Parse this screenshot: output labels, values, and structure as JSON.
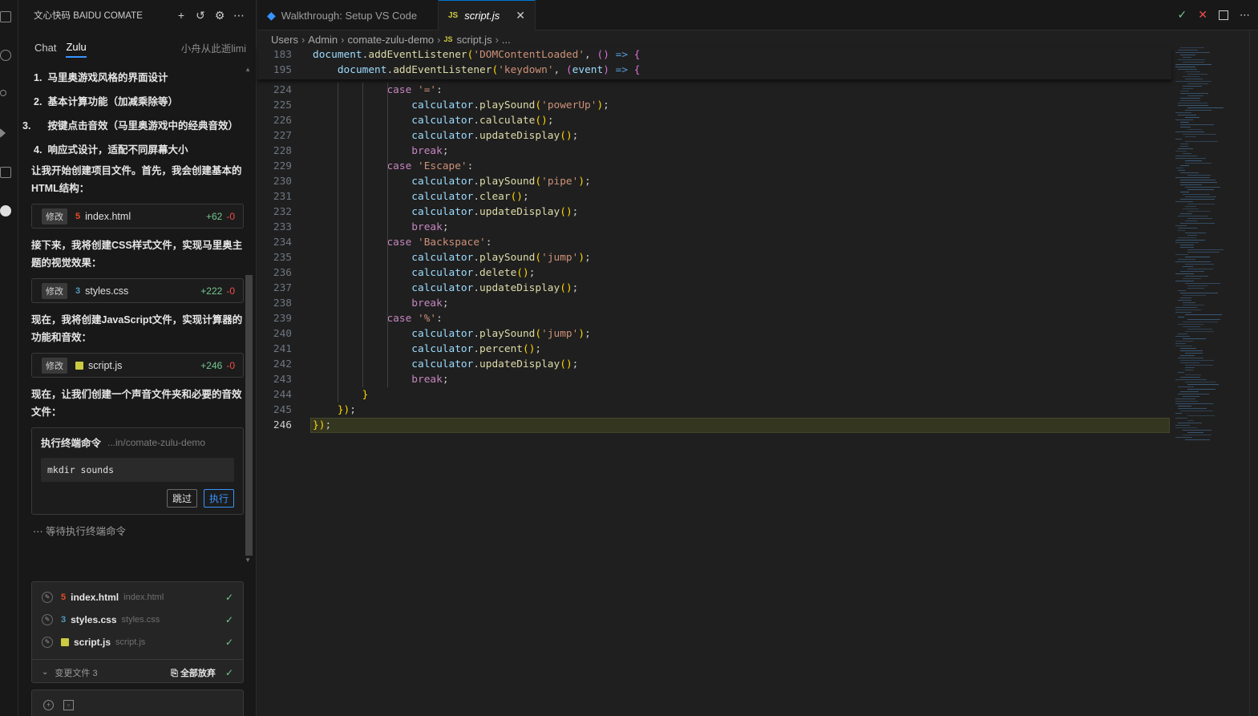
{
  "sidebar": {
    "title": "文心快码 BAIDU COMATE",
    "tabs": {
      "chat": "Chat",
      "zulu": "Zulu"
    },
    "user": "小舟从此逝limi",
    "list": [
      {
        "num": "1.",
        "text": "马里奥游戏风格的界面设计"
      },
      {
        "num": "2.",
        "text": "基本计算功能（加减乘除等）"
      },
      {
        "num": "3.",
        "text": "按键点击音效（马里奥游戏中的经典音效）"
      },
      {
        "num": "4.",
        "text": "响应式设计，适配不同屏幕大小"
      }
    ],
    "para1": "让我开始创建项目文件。首先，我会创建基本的HTML结构：",
    "card_html": {
      "badge": "修改",
      "name": "index.html",
      "add": "+62",
      "del": "-0"
    },
    "para2": "接下来，我将创建CSS样式文件，实现马里奥主题的视觉效果：",
    "card_css": {
      "badge": "修改",
      "name": "styles.css",
      "add": "+222",
      "del": "-0"
    },
    "para3": "现在，我将创建JavaScript文件，实现计算器的功能和音效：",
    "card_js": {
      "badge": "修改",
      "name": "script.js",
      "add": "+246",
      "del": "-0"
    },
    "para4": "现在，让我们创建一个声音文件夹和必要的音效文件：",
    "terminal": {
      "title": "执行终端命令",
      "path": "...in/comate-zulu-demo",
      "command": "mkdir sounds",
      "skip": "跳过",
      "run": "执行"
    },
    "waiting": "等待执行终端命令",
    "changed_files": [
      {
        "name": "index.html",
        "path": "index.html",
        "type": "html"
      },
      {
        "name": "styles.css",
        "path": "styles.css",
        "type": "css"
      },
      {
        "name": "script.js",
        "path": "script.js",
        "type": "js"
      }
    ],
    "changed_count": "变更文件 3",
    "discard_all": "全部放弃"
  },
  "editor": {
    "tabs": [
      {
        "label": "Walkthrough: Setup VS Code",
        "active": false
      },
      {
        "label": "script.js",
        "active": true
      }
    ],
    "breadcrumb": [
      "Users",
      "Admin",
      "comate-zulu-demo",
      "script.js",
      "..."
    ],
    "sticky_lines": [
      {
        "n": "183",
        "code": "document.addEventListener('DOMContentLoaded', () => {"
      },
      {
        "n": "195",
        "code": "    document.addEventListener('keydown', (event) => {"
      }
    ],
    "lines": [
      {
        "n": "224",
        "code": "            case '=':"
      },
      {
        "n": "225",
        "code": "                calculator.playSound('powerUp');"
      },
      {
        "n": "226",
        "code": "                calculator.calculate();"
      },
      {
        "n": "227",
        "code": "                calculator.updateDisplay();"
      },
      {
        "n": "228",
        "code": "                break;"
      },
      {
        "n": "229",
        "code": "            case 'Escape':"
      },
      {
        "n": "230",
        "code": "                calculator.playSound('pipe');"
      },
      {
        "n": "231",
        "code": "                calculator.clear();"
      },
      {
        "n": "232",
        "code": "                calculator.updateDisplay();"
      },
      {
        "n": "233",
        "code": "                break;"
      },
      {
        "n": "234",
        "code": "            case 'Backspace':"
      },
      {
        "n": "235",
        "code": "                calculator.playSound('jump');"
      },
      {
        "n": "236",
        "code": "                calculator.delete();"
      },
      {
        "n": "237",
        "code": "                calculator.updateDisplay();"
      },
      {
        "n": "238",
        "code": "                break;"
      },
      {
        "n": "239",
        "code": "            case '%':"
      },
      {
        "n": "240",
        "code": "                calculator.playSound('jump');"
      },
      {
        "n": "241",
        "code": "                calculator.percent();"
      },
      {
        "n": "242",
        "code": "                calculator.updateDisplay();"
      },
      {
        "n": "243",
        "code": "                break;"
      },
      {
        "n": "244",
        "code": "        }"
      },
      {
        "n": "245",
        "code": "    });"
      },
      {
        "n": "246",
        "code": "});",
        "current": true
      }
    ]
  },
  "colors": {
    "accent": "#3794ff",
    "added": "#73c991",
    "removed": "#f14c4c",
    "js_icon": "#cbcb41",
    "html_icon": "#e44d26",
    "css_icon": "#519aba"
  }
}
